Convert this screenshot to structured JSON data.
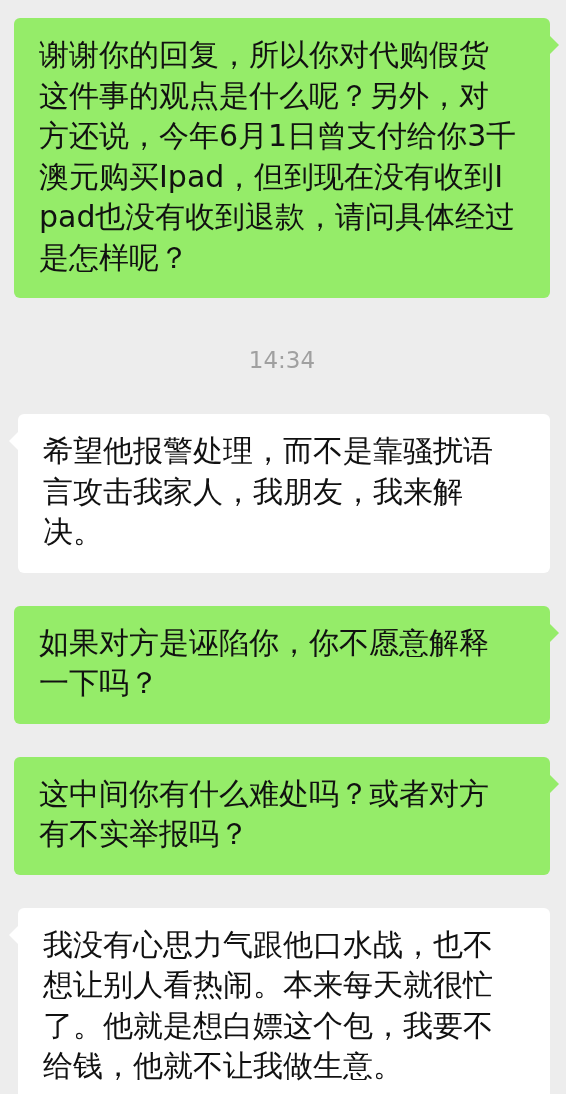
{
  "messages": [
    {
      "kind": "sent",
      "text": "谢谢你的回复，所以你对代购假货这件事的观点是什么呢？另外，对方还说，今年6月1日曾支付给你3千澳元购买Ipad，但到现在没有收到Ipad也没有收到退款，请问具体经过是怎样呢？"
    },
    {
      "kind": "time",
      "text": "14:34"
    },
    {
      "kind": "received",
      "text": "希望他报警处理，而不是靠骚扰语言攻击我家人，我朋友，我来解决。"
    },
    {
      "kind": "sent",
      "text": "如果对方是诬陷你，你不愿意解释一下吗？"
    },
    {
      "kind": "sent",
      "text": "这中间你有什么难处吗？或者对方有不实举报吗？"
    },
    {
      "kind": "received",
      "text": "我没有心思力气跟他口水战，也不想让别人看热闹。本来每天就很忙了。他就是想白嫖这个包，我要不给钱，他就不让我做生意。"
    }
  ]
}
